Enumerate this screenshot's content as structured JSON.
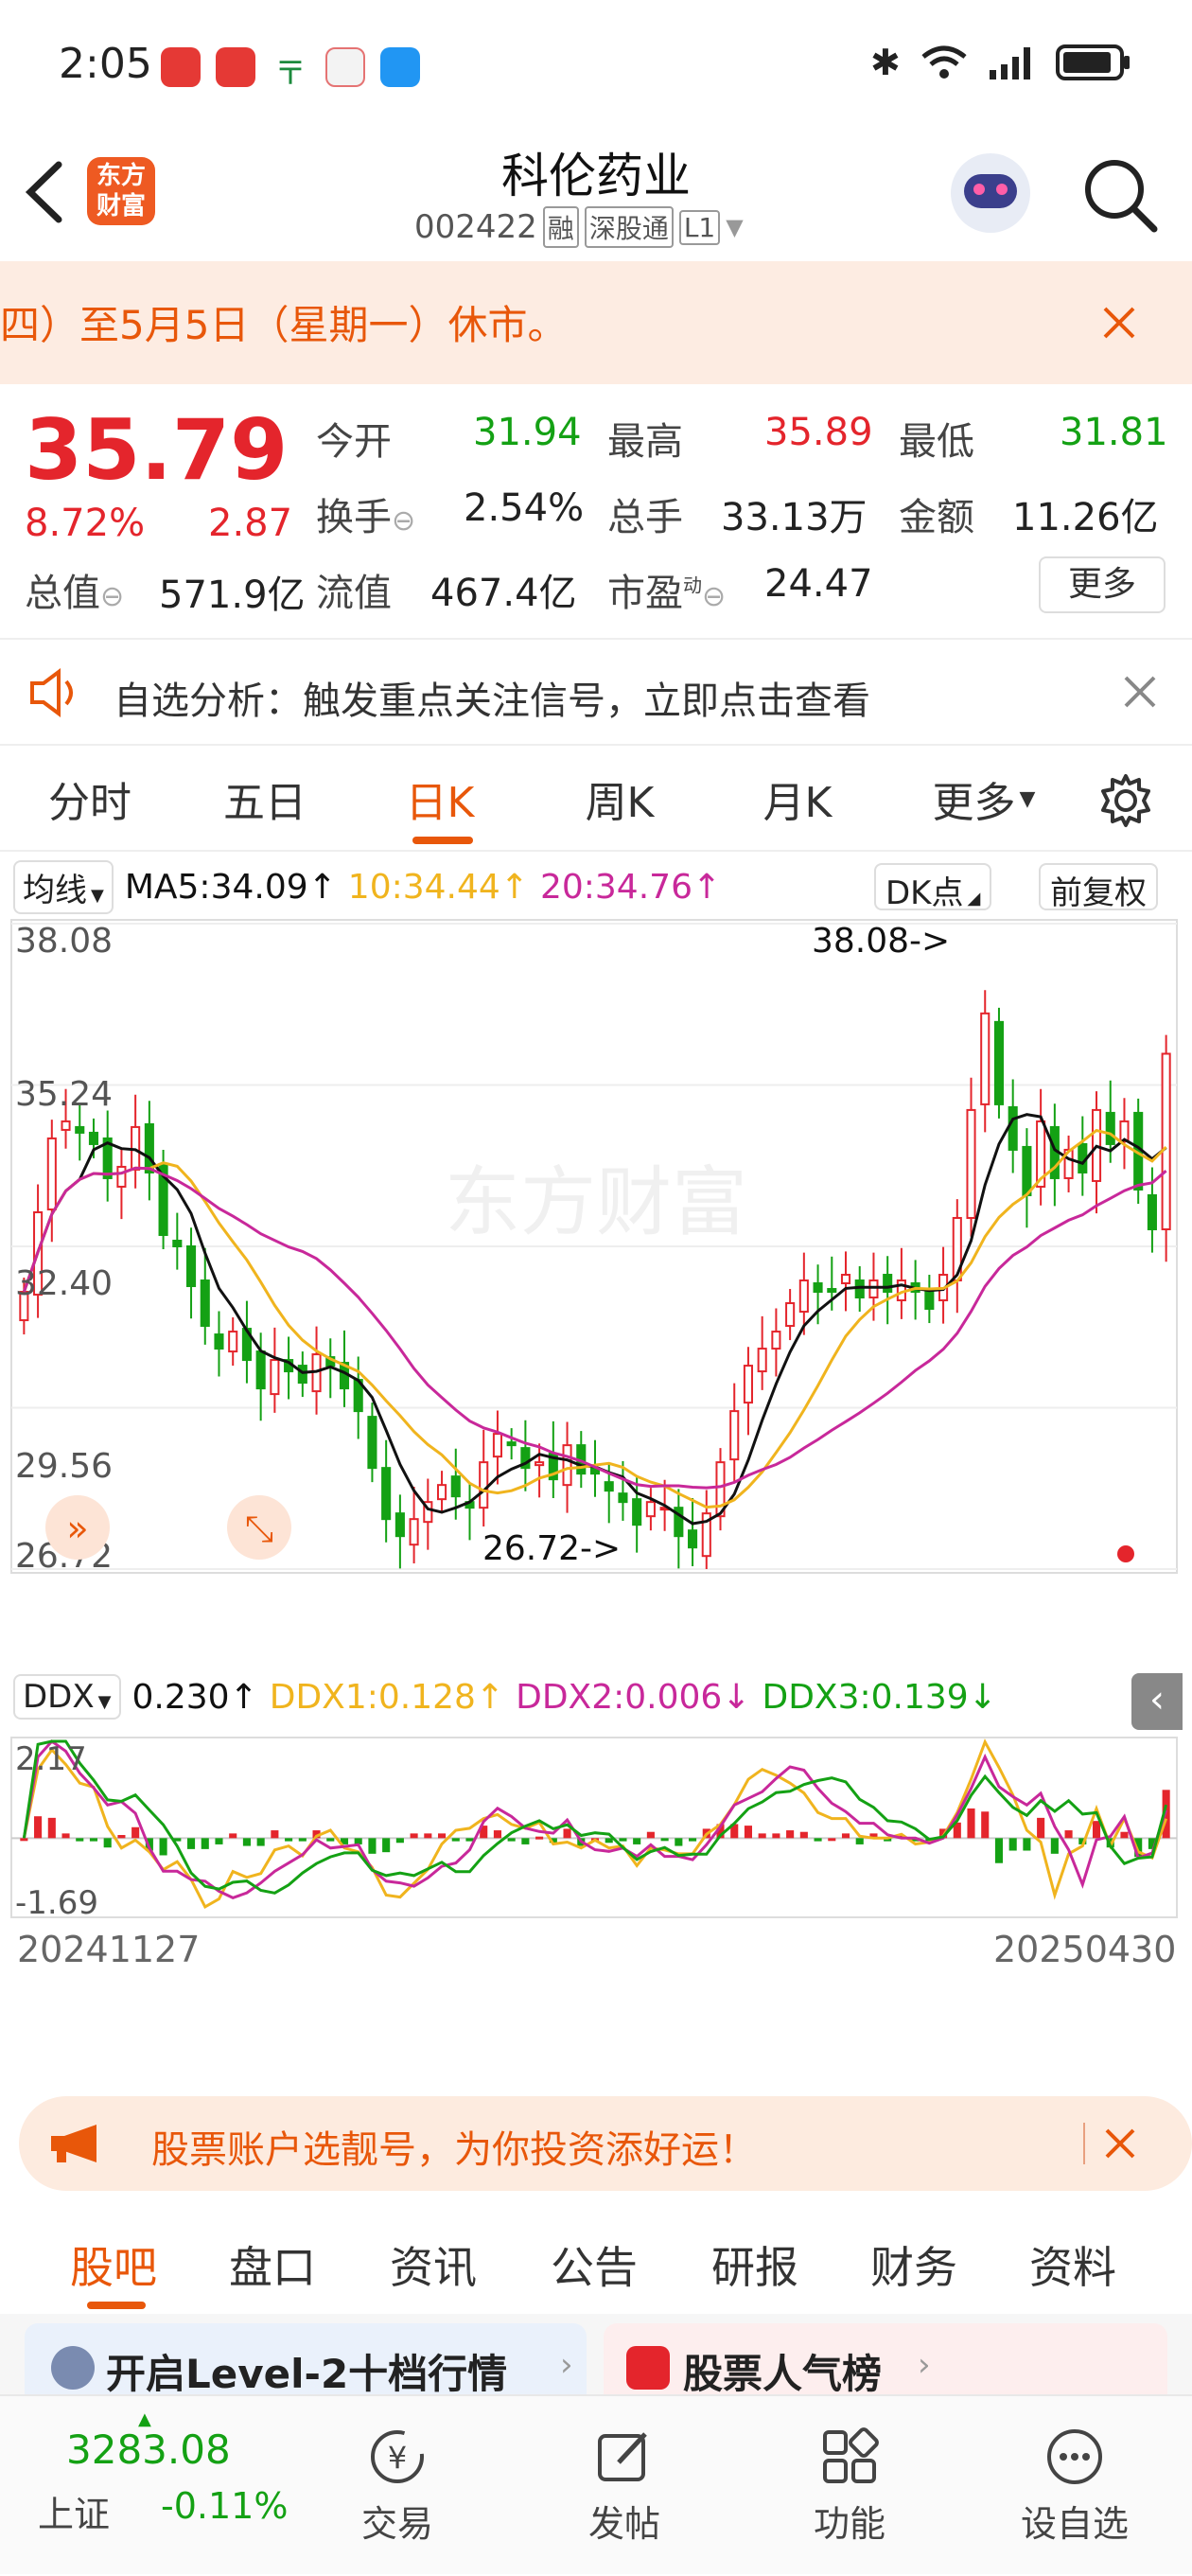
{
  "status_bar": {
    "time": "2:05"
  },
  "header": {
    "title": "科伦药业",
    "code": "002422",
    "tags": [
      "融",
      "深股通",
      "L1"
    ],
    "logo_text_1": "东方",
    "logo_text_2": "财富"
  },
  "notice": {
    "text": "四）至5月5日（星期一）休市。"
  },
  "quote": {
    "price": "35.79",
    "change_pct": "8.72%",
    "change_amt": "2.87",
    "open_label": "今开",
    "open": "31.94",
    "high_label": "最高",
    "high": "35.89",
    "low_label": "最低",
    "low": "31.81",
    "turnover_label": "换手",
    "turnover": "2.54%",
    "volume_label": "总手",
    "volume": "33.13万",
    "amount_label": "金额",
    "amount": "11.26亿",
    "mktcap_label": "总值",
    "mktcap": "571.9亿",
    "float_label": "流值",
    "float": "467.4亿",
    "pe_label": "市盈",
    "pe_sup": "动",
    "pe": "24.47",
    "more_label": "更多"
  },
  "signal": {
    "text": "自选分析：触发重点关注信号，立即点击查看"
  },
  "tabs": [
    "分时",
    "五日",
    "日K",
    "周K",
    "月K",
    "更多"
  ],
  "active_tab": 2,
  "ma_bar": {
    "selector": "均线",
    "ma5": "MA5:34.09↑",
    "ma10": "10:34.44↑",
    "ma20": "20:34.76↑",
    "dk": "DK点",
    "adjust": "前复权"
  },
  "kline": {
    "y_labels": [
      "38.08",
      "35.24",
      "32.40",
      "29.56",
      "26.72"
    ],
    "high_annotation": "38.08->",
    "low_annotation": "26.72->",
    "watermark": "东方财富"
  },
  "ddx_bar": {
    "selector": "DDX",
    "ddx": "0.230↑",
    "ddx1": "DDX1:0.128↑",
    "ddx2": "DDX2:0.006↓",
    "ddx3": "DDX3:0.139↓"
  },
  "ddx_chart": {
    "y_top": "2.17",
    "y_bottom": "-1.69"
  },
  "dates": {
    "start": "20241127",
    "end": "20250430"
  },
  "colors": {
    "up": "#e4252c",
    "down": "#14a114",
    "ma5": "#111111",
    "ma10": "#f0b41e",
    "ma20": "#c8289a",
    "accent": "#e8570a"
  },
  "banner": {
    "text": "股票账户选靓号，为你投资添好运！"
  },
  "subtabs": [
    "股吧",
    "盘口",
    "资讯",
    "公告",
    "研报",
    "财务",
    "资料"
  ],
  "active_subtab": 0,
  "cards": {
    "left": "开启Level-2十档行情",
    "right": "股票人气榜"
  },
  "bottom_nav": {
    "index_value": "3283.08",
    "index_name": "上证",
    "index_change": "-0.11%",
    "items": [
      "交易",
      "发帖",
      "功能",
      "设自选"
    ]
  },
  "chart_data": {
    "type": "candlestick",
    "x_range": [
      "20241127",
      "20250430"
    ],
    "y_range": [
      26.72,
      38.08
    ],
    "y_ticks": [
      38.08,
      35.24,
      32.4,
      29.56,
      26.72
    ],
    "high_marker": 38.08,
    "low_marker": 26.72,
    "close_series": [
      31.6,
      33.0,
      34.3,
      34.6,
      34.4,
      34.2,
      33.6,
      33.8,
      34.5,
      33.7,
      32.6,
      32.4,
      31.7,
      31.0,
      30.6,
      30.9,
      30.4,
      29.9,
      30.4,
      30.2,
      30.0,
      30.5,
      30.3,
      29.9,
      29.5,
      28.5,
      27.6,
      27.3,
      27.6,
      27.9,
      28.2,
      28.0,
      27.8,
      28.6,
      29.1,
      28.9,
      28.5,
      28.6,
      28.3,
      28.9,
      28.4,
      28.4,
      28.1,
      27.9,
      27.5,
      27.9,
      27.8,
      27.3,
      27.1,
      27.7,
      28.6,
      29.5,
      30.3,
      30.6,
      30.9,
      31.4,
      31.8,
      31.6,
      31.6,
      31.9,
      31.5,
      31.8,
      31.6,
      31.8,
      31.6,
      31.3,
      31.9,
      32.9,
      34.8,
      36.5,
      34.9,
      34.1,
      33.3,
      34.6,
      33.6,
      34.1,
      33.7,
      34.8,
      34.2,
      34.6,
      33.4,
      32.7,
      35.79
    ]
  }
}
